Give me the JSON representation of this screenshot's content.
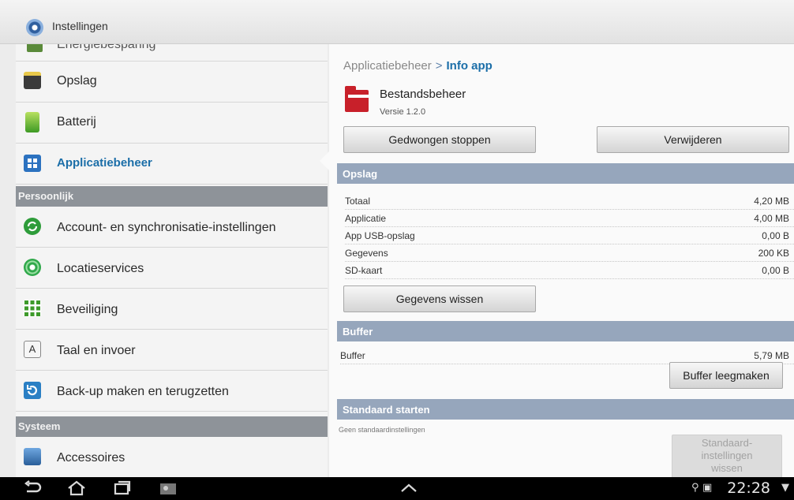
{
  "window": {
    "title": "Instellingen"
  },
  "sidebar": {
    "partial_item": "Energiebesparing",
    "items": [
      {
        "label": "Opslag",
        "icon": "sd-card-icon"
      },
      {
        "label": "Batterij",
        "icon": "battery-icon"
      },
      {
        "label": "Applicatiebeheer",
        "icon": "apps-grid-icon",
        "selected": true
      },
      {
        "label": "Account- en synchronisatie-instellingen",
        "icon": "sync-icon"
      },
      {
        "label": "Locatieservices",
        "icon": "location-icon"
      },
      {
        "label": "Beveiliging",
        "icon": "security-icon"
      },
      {
        "label": "Taal en invoer",
        "icon": "keyboard-icon"
      },
      {
        "label": "Back-up maken en terugzetten",
        "icon": "backup-icon"
      },
      {
        "label": "Accessoires",
        "icon": "accessory-icon"
      }
    ],
    "sections": {
      "personal": "Persoonlijk",
      "system": "Systeem"
    }
  },
  "detail": {
    "breadcrumb": {
      "parent": "Applicatiebeheer",
      "separator": ">",
      "current": "Info app"
    },
    "app": {
      "name": "Bestandsbeheer",
      "version": "Versie 1.2.0"
    },
    "buttons": {
      "force_stop": "Gedwongen stoppen",
      "uninstall": "Verwijderen",
      "clear_data": "Gegevens wissen",
      "clear_cache": "Buffer leegmaken",
      "clear_defaults": "Standaard-\ninstellingen\nwissen"
    },
    "storage": {
      "header": "Opslag",
      "rows": [
        {
          "label": "Totaal",
          "value": "4,20 MB"
        },
        {
          "label": "Applicatie",
          "value": "4,00 MB"
        },
        {
          "label": "App USB-opslag",
          "value": "0,00 B"
        },
        {
          "label": "Gegevens",
          "value": "200 KB"
        },
        {
          "label": "SD-kaart",
          "value": "0,00 B"
        }
      ]
    },
    "cache": {
      "header": "Buffer",
      "label": "Buffer",
      "value": "5,79 MB"
    },
    "defaults": {
      "header": "Standaard starten",
      "note": "Geen standaardinstellingen"
    }
  },
  "navbar": {
    "time": "22:28"
  },
  "colors": {
    "accent": "#1b6ea8",
    "section_left": "#8e9399",
    "section_right": "#96a6bc"
  }
}
